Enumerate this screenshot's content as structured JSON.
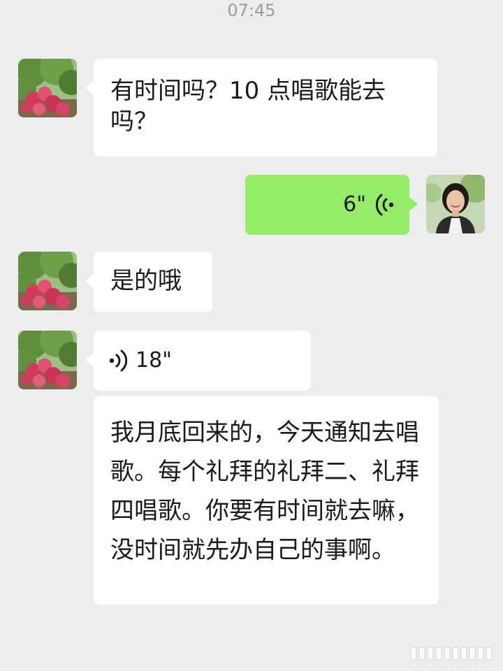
{
  "status": {
    "time": "07:45"
  },
  "messages": [
    {
      "side": "in",
      "type": "text",
      "text": "有时间吗？10 点唱歌能去吗？"
    },
    {
      "side": "out",
      "type": "voice",
      "duration": "6\""
    },
    {
      "side": "in",
      "type": "text",
      "text": "是的哦"
    },
    {
      "side": "in",
      "type": "voice",
      "duration": "18\""
    },
    {
      "side": "in",
      "type": "text",
      "text": "我月底回来的，今天通知去唱歌。每个礼拜的礼拜二、礼拜四唱歌。你要有时间就去嘛，没时间就先办自己的事啊。"
    }
  ],
  "colors": {
    "background": "#ededed",
    "incoming_bubble": "#ffffff",
    "outgoing_bubble": "#95ec69",
    "timestamp": "#9c9c9c"
  },
  "icons": {
    "voice_out": "voice-wave-icon",
    "voice_in": "voice-wave-icon",
    "contact_avatar": "flowering-tree-photo",
    "self_avatar": "woman-portrait-photo"
  }
}
